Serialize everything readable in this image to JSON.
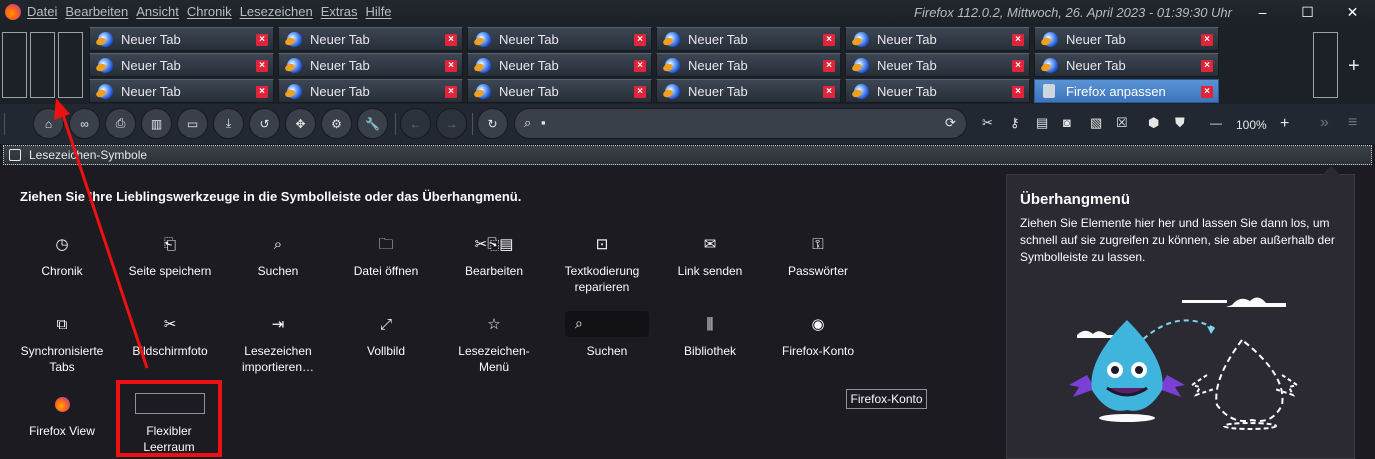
{
  "menubar": [
    "Datei",
    "Bearbeiten",
    "Ansicht",
    "Chronik",
    "Lesezeichen",
    "Extras",
    "Hilfe"
  ],
  "window": {
    "title": "Firefox 112.0.2, Mittwoch, 26. April 2023 - 01:39:30 Uhr",
    "minimize": "–",
    "maximize": "☐",
    "close": "✕"
  },
  "tabs": {
    "row1": [
      "Neuer Tab",
      "Neuer Tab",
      "Neuer Tab",
      "Neuer Tab",
      "Neuer Tab",
      "Neuer Tab"
    ],
    "row2": [
      "Neuer Tab",
      "Neuer Tab",
      "Neuer Tab",
      "Neuer Tab",
      "Neuer Tab",
      "Neuer Tab"
    ],
    "row3": [
      "Neuer Tab",
      "Neuer Tab",
      "Neuer Tab",
      "Neuer Tab",
      "Neuer Tab",
      "Firefox anpassen"
    ],
    "close_glyph": "×",
    "new_tab": "+"
  },
  "navbar": {
    "zoom": "100%",
    "zoom_minus": "—",
    "zoom_plus": "+"
  },
  "bookmarks": {
    "label": "Lesezeichen-Symbole"
  },
  "palette": {
    "instruction": "Ziehen Sie Ihre Lieblingswerkzeuge in die Symbolleiste oder das Überhangmenü.",
    "items_row1": [
      "Chronik",
      "Seite speichern",
      "Suchen",
      "Datei öffnen",
      "Bearbeiten",
      "Textkodierung reparieren",
      "Link senden",
      "Passwörter"
    ],
    "items_row2": [
      "Synchronisierte Tabs",
      "Bildschirmfoto",
      "Lesezeichen importieren…",
      "Vollbild",
      "Lesezeichen-Menü",
      "Suchen",
      "Bibliothek",
      "Firefox-Konto"
    ],
    "items_row3": [
      "Firefox View",
      "Flexibler Leerraum"
    ],
    "tooltip": "Firefox-Konto"
  },
  "overflow": {
    "title": "Überhangmenü",
    "description": "Ziehen Sie Elemente hier her und lassen Sie dann los, um schnell auf sie zugreifen zu können, sie aber außerhalb der Symbolleiste zu lassen."
  },
  "colors": {
    "accent": "#e11111",
    "selected_tab": "#4a86cc",
    "close": "#e0243a"
  }
}
